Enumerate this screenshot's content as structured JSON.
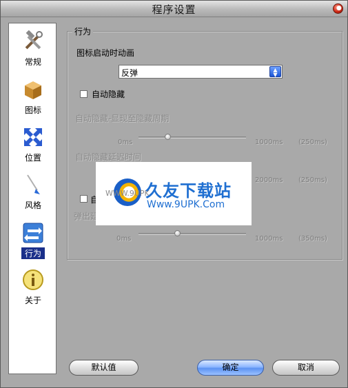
{
  "window": {
    "title": "程序设置"
  },
  "sidebar": {
    "items": [
      {
        "label": "常规",
        "icon": "hammer-wrench-icon"
      },
      {
        "label": "图标",
        "icon": "package-box-icon"
      },
      {
        "label": "位置",
        "icon": "move-arrows-icon"
      },
      {
        "label": "风格",
        "icon": "paintbrush-icon"
      },
      {
        "label": "行为",
        "icon": "behavior-arrows-icon",
        "active": true
      },
      {
        "label": "关于",
        "icon": "info-icon"
      }
    ]
  },
  "behavior": {
    "group_title": "行为",
    "animation_label": "图标启动时动画",
    "animation_value": "反弹",
    "autohide_label": "自动隐藏",
    "autohide_cycle_label": "自动隐藏-显现至隐藏周期",
    "slider1": {
      "min_label": "0ms",
      "max_label": "1000ms",
      "value_label": "(250ms)",
      "value": 250
    },
    "autohide_delay_label": "自动隐藏延迟时间",
    "slider2": {
      "max_label": "2000ms",
      "value_label": "(250ms)"
    },
    "bounce_checkbox_label": "自",
    "bounce_partial_label": "弹出延",
    "slider3": {
      "min_label": "0ms",
      "max_label": "1000ms",
      "value_label": "(350ms)",
      "value": 350
    }
  },
  "footer": {
    "default_button": "默认值",
    "ok_button": "确定",
    "cancel_button": "取消"
  },
  "watermark": {
    "title": "久友下载站",
    "url": "Www.9UPK.Com",
    "small": "WWW.9UPK"
  },
  "colors": {
    "accent": "#1a2f8a",
    "window_bg": "#a9a9a9",
    "watermark_blue": "#1f6fd1"
  }
}
